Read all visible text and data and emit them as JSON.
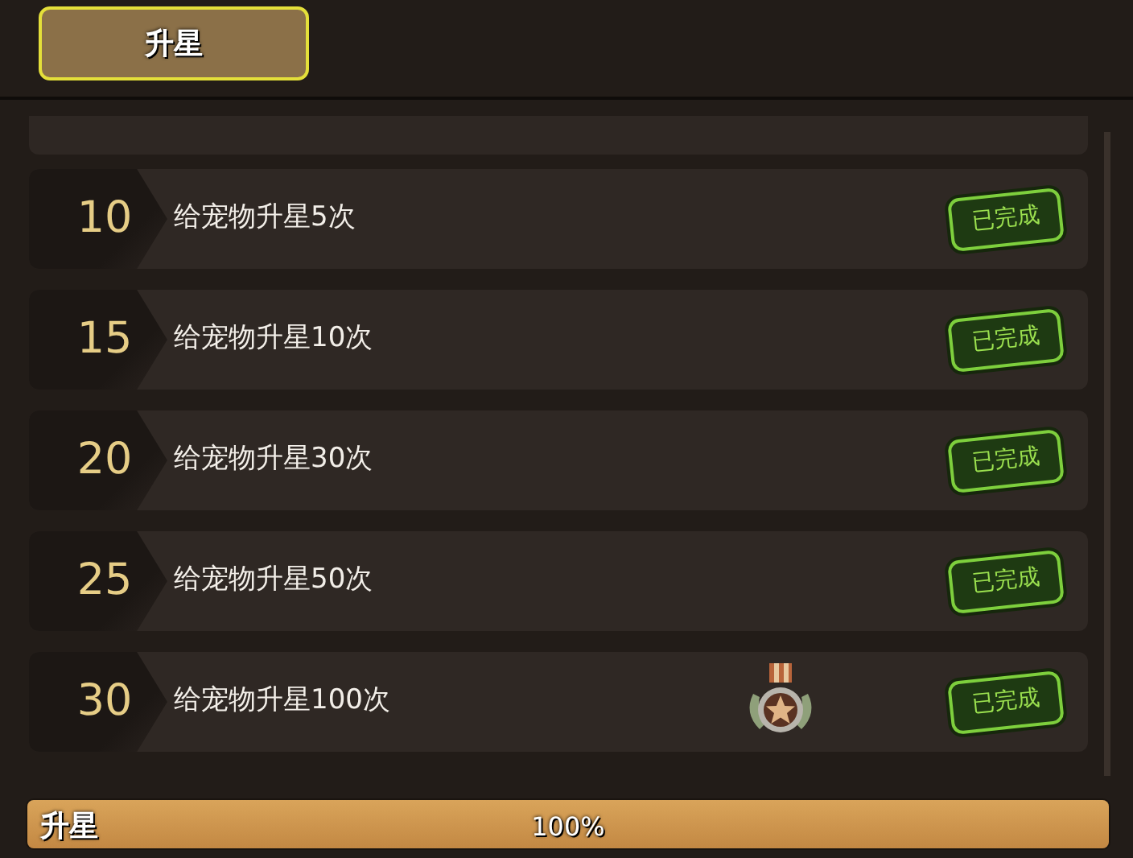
{
  "tabs": [
    {
      "label": "升星",
      "selected": true
    }
  ],
  "tasks": [
    {
      "level": "10",
      "task": "给宠物升星5次",
      "reward": false,
      "status": "已完成"
    },
    {
      "level": "15",
      "task": "给宠物升星10次",
      "reward": false,
      "status": "已完成"
    },
    {
      "level": "20",
      "task": "给宠物升星30次",
      "reward": false,
      "status": "已完成"
    },
    {
      "level": "25",
      "task": "给宠物升星50次",
      "reward": false,
      "status": "已完成"
    },
    {
      "level": "30",
      "task": "给宠物升星100次",
      "reward": true,
      "status": "已完成"
    }
  ],
  "progress": {
    "label": "升星",
    "reading": "100%",
    "level": 1
  }
}
